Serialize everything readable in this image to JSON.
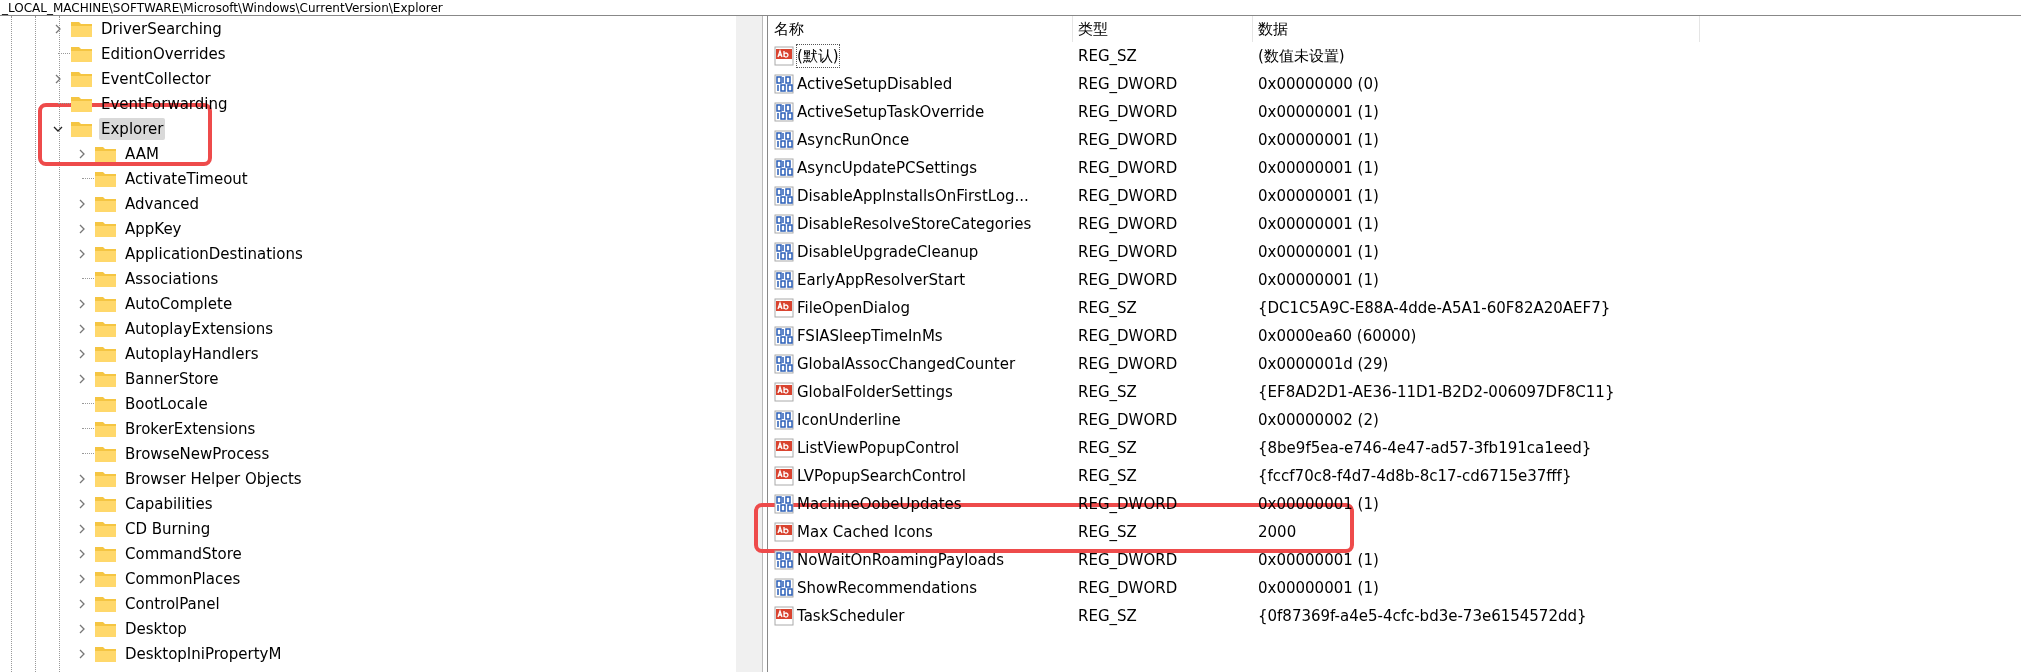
{
  "address_bar": {
    "path": "_LOCAL_MACHINE\\SOFTWARE\\Microsoft\\Windows\\CurrentVersion\\Explorer"
  },
  "tree": [
    {
      "label": "DriverSearching",
      "expandable": true,
      "expanded": false,
      "selected": false
    },
    {
      "label": "EditionOverrides",
      "expandable": false,
      "selected": false
    },
    {
      "label": "EventCollector",
      "expandable": true,
      "expanded": false,
      "selected": false
    },
    {
      "label": "EventForwarding",
      "expandable": false,
      "selected": false
    },
    {
      "label": "Explorer",
      "expandable": true,
      "expanded": true,
      "selected": true,
      "children": [
        {
          "label": "AAM",
          "expandable": true,
          "expanded": false,
          "selected": false
        },
        {
          "label": "ActivateTimeout",
          "expandable": false,
          "selected": false
        },
        {
          "label": "Advanced",
          "expandable": true,
          "expanded": false,
          "selected": false
        },
        {
          "label": "AppKey",
          "expandable": true,
          "expanded": false,
          "selected": false
        },
        {
          "label": "ApplicationDestinations",
          "expandable": true,
          "expanded": false,
          "selected": false
        },
        {
          "label": "Associations",
          "expandable": false,
          "selected": false
        },
        {
          "label": "AutoComplete",
          "expandable": true,
          "expanded": false,
          "selected": false
        },
        {
          "label": "AutoplayExtensions",
          "expandable": true,
          "expanded": false,
          "selected": false
        },
        {
          "label": "AutoplayHandlers",
          "expandable": true,
          "expanded": false,
          "selected": false
        },
        {
          "label": "BannerStore",
          "expandable": true,
          "expanded": false,
          "selected": false
        },
        {
          "label": "BootLocale",
          "expandable": false,
          "selected": false
        },
        {
          "label": "BrokerExtensions",
          "expandable": false,
          "selected": false
        },
        {
          "label": "BrowseNewProcess",
          "expandable": false,
          "selected": false
        },
        {
          "label": "Browser Helper Objects",
          "expandable": true,
          "expanded": false,
          "selected": false
        },
        {
          "label": "Capabilities",
          "expandable": true,
          "expanded": false,
          "selected": false
        },
        {
          "label": "CD Burning",
          "expandable": true,
          "expanded": false,
          "selected": false
        },
        {
          "label": "CommandStore",
          "expandable": true,
          "expanded": false,
          "selected": false
        },
        {
          "label": "CommonPlaces",
          "expandable": true,
          "expanded": false,
          "selected": false
        },
        {
          "label": "ControlPanel",
          "expandable": true,
          "expanded": false,
          "selected": false
        },
        {
          "label": "Desktop",
          "expandable": true,
          "expanded": false,
          "selected": false
        },
        {
          "label": "DesktopIniPropertyM",
          "expandable": true,
          "expanded": false,
          "selected": false
        }
      ]
    }
  ],
  "values": {
    "columns": [
      "名称",
      "类型",
      "数据"
    ],
    "rows": [
      {
        "kind": "string",
        "name": "(默认)",
        "type": "REG_SZ",
        "data": "(数值未设置)",
        "focused": true
      },
      {
        "kind": "dword",
        "name": "ActiveSetupDisabled",
        "type": "REG_DWORD",
        "data": "0x00000000 (0)",
        "focused": false
      },
      {
        "kind": "dword",
        "name": "ActiveSetupTaskOverride",
        "type": "REG_DWORD",
        "data": "0x00000001 (1)",
        "focused": false
      },
      {
        "kind": "dword",
        "name": "AsyncRunOnce",
        "type": "REG_DWORD",
        "data": "0x00000001 (1)",
        "focused": false
      },
      {
        "kind": "dword",
        "name": "AsyncUpdatePCSettings",
        "type": "REG_DWORD",
        "data": "0x00000001 (1)",
        "focused": false
      },
      {
        "kind": "dword",
        "name": "DisableAppInstallsOnFirstLog...",
        "type": "REG_DWORD",
        "data": "0x00000001 (1)",
        "focused": false
      },
      {
        "kind": "dword",
        "name": "DisableResolveStoreCategories",
        "type": "REG_DWORD",
        "data": "0x00000001 (1)",
        "focused": false
      },
      {
        "kind": "dword",
        "name": "DisableUpgradeCleanup",
        "type": "REG_DWORD",
        "data": "0x00000001 (1)",
        "focused": false
      },
      {
        "kind": "dword",
        "name": "EarlyAppResolverStart",
        "type": "REG_DWORD",
        "data": "0x00000001 (1)",
        "focused": false
      },
      {
        "kind": "string",
        "name": "FileOpenDialog",
        "type": "REG_SZ",
        "data": "{DC1C5A9C-E88A-4dde-A5A1-60F82A20AEF7}",
        "focused": false
      },
      {
        "kind": "dword",
        "name": "FSIASleepTimeInMs",
        "type": "REG_DWORD",
        "data": "0x0000ea60 (60000)",
        "focused": false
      },
      {
        "kind": "dword",
        "name": "GlobalAssocChangedCounter",
        "type": "REG_DWORD",
        "data": "0x0000001d (29)",
        "focused": false
      },
      {
        "kind": "string",
        "name": "GlobalFolderSettings",
        "type": "REG_SZ",
        "data": "{EF8AD2D1-AE36-11D1-B2D2-006097DF8C11}",
        "focused": false
      },
      {
        "kind": "dword",
        "name": "IconUnderline",
        "type": "REG_DWORD",
        "data": "0x00000002 (2)",
        "focused": false
      },
      {
        "kind": "string",
        "name": "ListViewPopupControl",
        "type": "REG_SZ",
        "data": "{8be9f5ea-e746-4e47-ad57-3fb191ca1eed}",
        "focused": false
      },
      {
        "kind": "string",
        "name": "LVPopupSearchControl",
        "type": "REG_SZ",
        "data": "{fccf70c8-f4d7-4d8b-8c17-cd6715e37fff}",
        "focused": false
      },
      {
        "kind": "dword",
        "name": "MachineOobeUpdates",
        "type": "REG_DWORD",
        "data": "0x00000001 (1)",
        "focused": false
      },
      {
        "kind": "string",
        "name": "Max Cached Icons",
        "type": "REG_SZ",
        "data": "2000",
        "focused": false
      },
      {
        "kind": "dword",
        "name": "NoWaitOnRoamingPayloads",
        "type": "REG_DWORD",
        "data": "0x00000001 (1)",
        "focused": false
      },
      {
        "kind": "dword",
        "name": "ShowRecommendations",
        "type": "REG_DWORD",
        "data": "0x00000001 (1)",
        "focused": false
      },
      {
        "kind": "string",
        "name": "TaskScheduler",
        "type": "REG_SZ",
        "data": "{0f87369f-a4e5-4cfc-bd3e-73e6154572dd}",
        "focused": false
      }
    ]
  }
}
